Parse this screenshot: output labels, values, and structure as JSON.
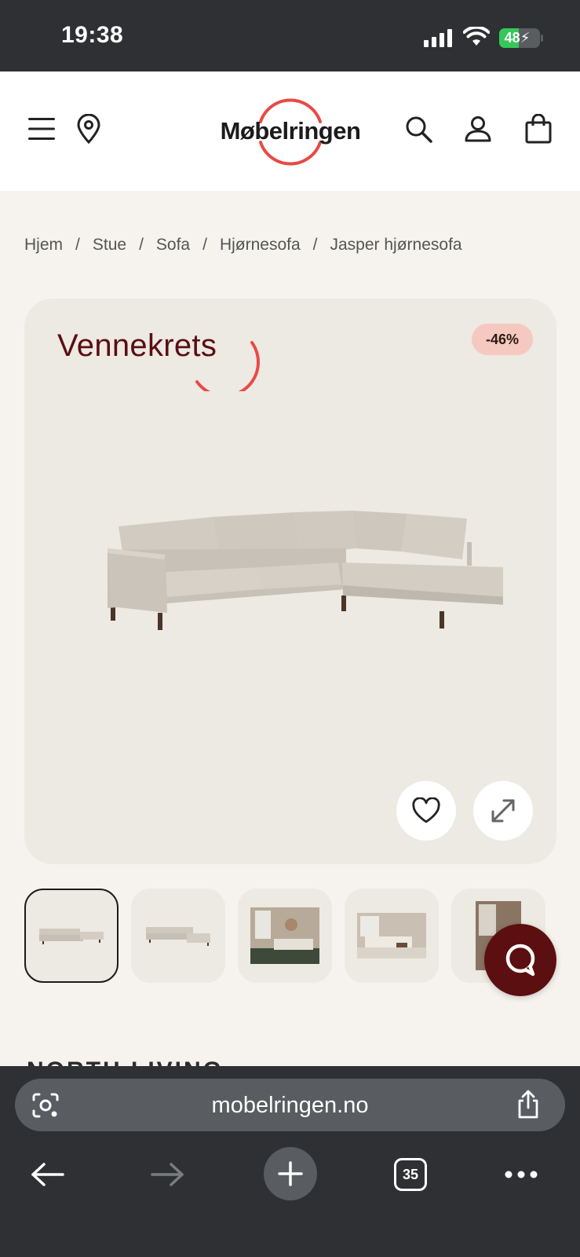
{
  "status_bar": {
    "time": "19:38",
    "battery": "48"
  },
  "header": {
    "logo_text": "Møbelringen",
    "icons": [
      "menu-icon",
      "location-pin-icon",
      "search-icon",
      "account-icon",
      "bag-icon"
    ]
  },
  "breadcrumb": {
    "items": [
      "Hjem",
      "Stue",
      "Sofa",
      "Hjørnesofa",
      "Jasper hjørnesofa"
    ],
    "separator": "/"
  },
  "product_image": {
    "brand_label": "Vennekrets",
    "discount_badge": "-46%",
    "favorite_icon": "heart-icon",
    "expand_icon": "expand-icon"
  },
  "thumbnails": {
    "count_visible": 5,
    "active_index": 0
  },
  "section_peek": "NORTH LIVING",
  "browser": {
    "url": "mobelringen.no",
    "tab_count": "35"
  },
  "colors": {
    "brand_red": "#e84a46",
    "vennekrets_maroon": "#5a0e12",
    "badge_bg": "#f5c9bf",
    "chat_bg": "#5c0f10",
    "card_bg": "#ede9e3",
    "page_bg": "#f6f3ef"
  }
}
